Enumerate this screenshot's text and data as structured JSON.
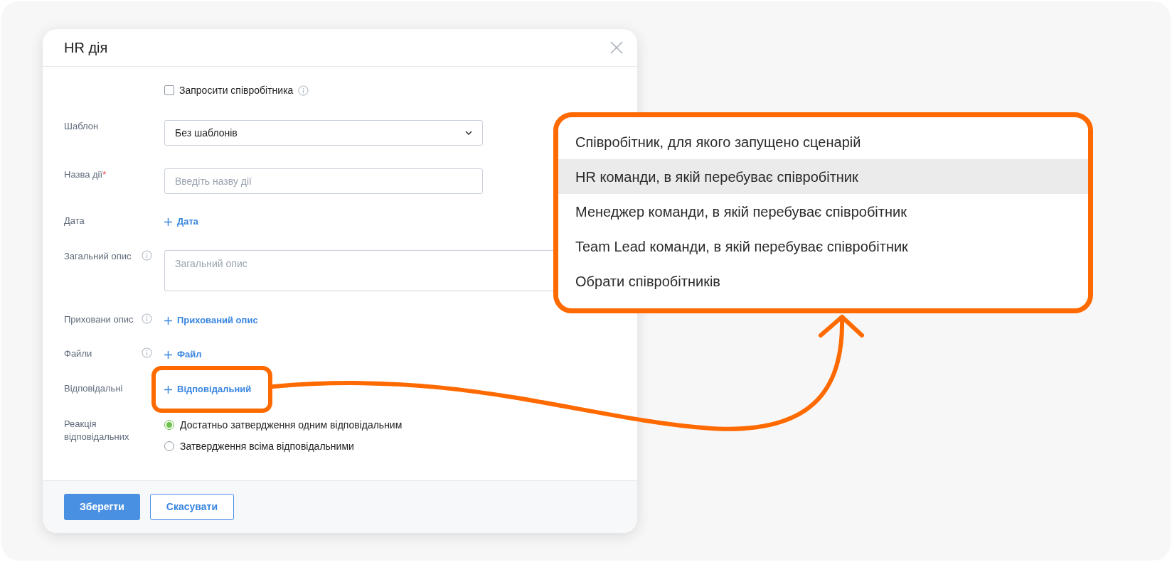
{
  "dialog": {
    "title": "HR дія",
    "invite_checkbox": {
      "label": "Запросити співробітника",
      "checked": false,
      "info": true
    },
    "fields": [
      {
        "kind": "select",
        "label": "Шаблон",
        "value": "Без шаблонів"
      },
      {
        "kind": "input",
        "label": "Назва дії",
        "required_mark": "*",
        "placeholder": "Введіть назву дії"
      },
      {
        "kind": "add",
        "label": "Дата",
        "action": "Дата"
      },
      {
        "kind": "textarea",
        "label": "Загальний опис",
        "info": true,
        "placeholder": "Загальний опис"
      },
      {
        "kind": "add",
        "label": "Приховани опис",
        "info": true,
        "action": "Прихований опис"
      },
      {
        "kind": "add",
        "label": "Файли",
        "info": true,
        "action": "Файл"
      },
      {
        "kind": "add",
        "label": "Відповідальні",
        "action": "Відповідальний",
        "highlighted": true
      },
      {
        "kind": "radio",
        "label": "Реакція відповідальних",
        "options": [
          {
            "label": "Достатньо затвердження одним відповідальним",
            "selected": true
          },
          {
            "label": "Затвердження всіма відповідальними",
            "selected": false
          }
        ]
      }
    ],
    "buttons": [
      {
        "label": "Зберегти",
        "primary": true
      },
      {
        "label": "Скасувати",
        "primary": false
      }
    ]
  },
  "callout": {
    "options": [
      {
        "label": "Співробітник, для якого запущено сценарій",
        "selected": false
      },
      {
        "label": "HR команди, в якій перебуває співробітник",
        "selected": true
      },
      {
        "label": "Менеджер команди, в якій перебуває співробітник",
        "selected": false
      },
      {
        "label": "Team Lead команди, в якій перебуває співробітник",
        "selected": false
      },
      {
        "label": "Обрати співробітників",
        "selected": false
      }
    ]
  }
}
